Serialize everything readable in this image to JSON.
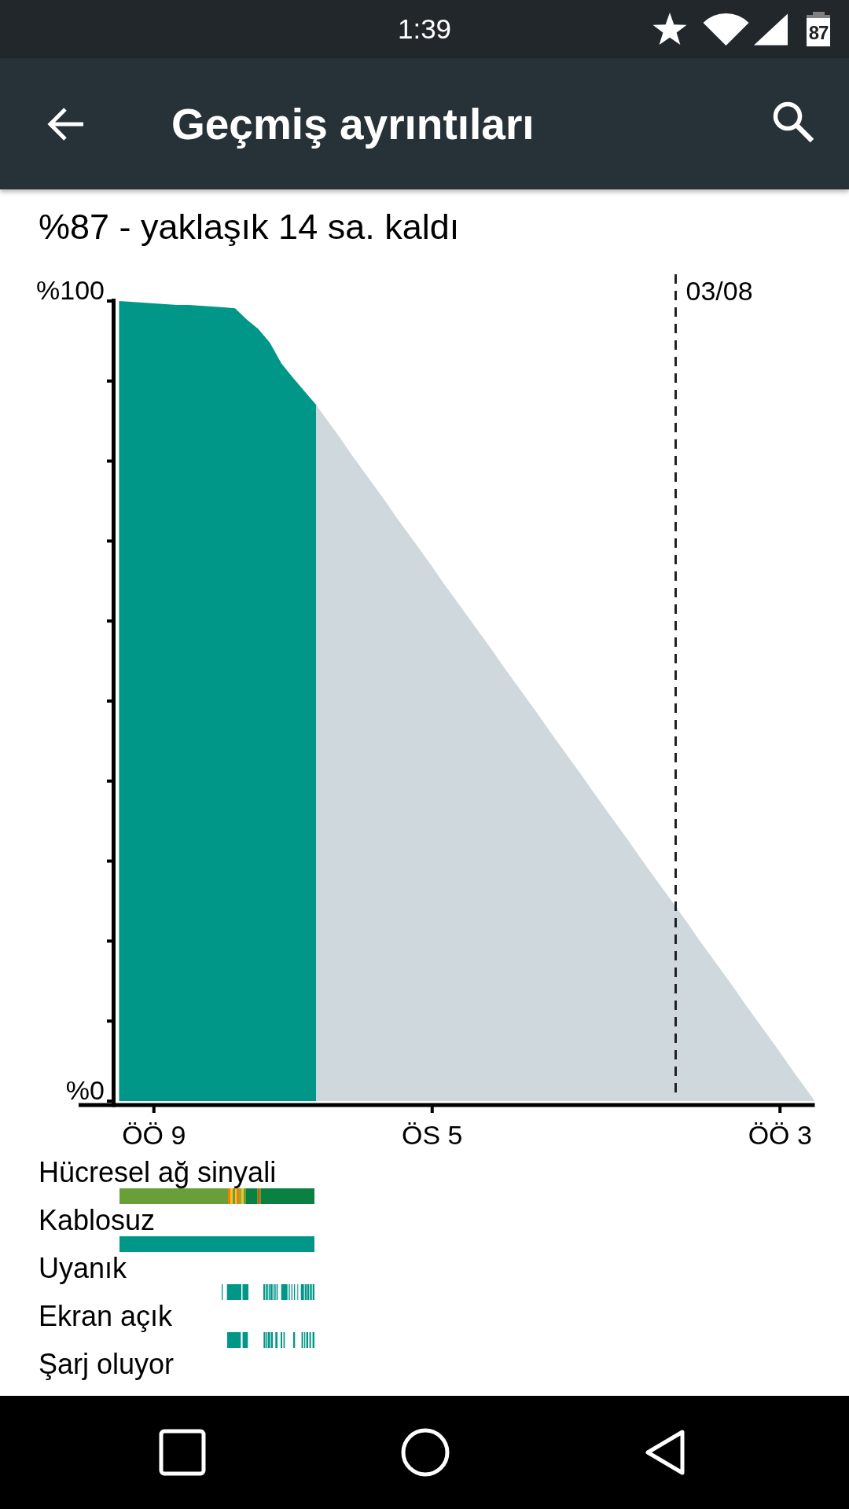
{
  "status_bar": {
    "time": "1:39",
    "battery_percent": "87"
  },
  "toolbar": {
    "title": "Geçmiş ayrıntıları"
  },
  "summary": "%87 - yaklaşık 14 sa. kaldı",
  "chart": {
    "chart_data": {
      "type": "area",
      "categories": [
        null,
        null,
        null,
        "ÖÖ 9",
        null,
        null,
        null,
        null,
        null,
        null,
        null,
        null,
        null,
        null,
        null,
        null,
        null,
        null,
        null,
        null,
        null,
        null,
        null,
        null,
        null,
        null,
        null,
        "ÖS 5",
        null,
        null,
        null,
        null,
        null,
        null,
        null,
        null,
        null,
        null,
        null,
        null,
        null,
        null,
        null,
        null,
        null,
        null,
        null,
        null,
        null,
        null,
        null,
        null,
        null,
        null,
        null,
        null,
        null,
        "ÖÖ 3",
        null,
        null,
        null
      ],
      "series": [
        {
          "color": "#009688",
          "values": [
            100,
            99.9,
            99.8,
            99.7,
            99.6,
            99.5,
            99.5,
            99.4,
            99.3,
            99.2,
            99.1,
            97.7,
            96.5,
            94.8,
            92.2,
            90.4,
            88.7,
            87,
            null,
            null,
            null,
            null,
            null,
            null,
            null,
            null,
            null,
            null,
            null,
            null,
            null,
            null,
            null,
            null,
            null,
            null,
            null,
            null,
            null,
            null,
            null,
            null,
            null,
            null,
            null,
            null,
            null,
            null,
            null,
            null,
            null,
            null,
            null,
            null,
            null,
            null,
            null,
            null,
            null,
            null,
            null
          ]
        },
        {
          "color": "#cfd8dc",
          "values": [
            null,
            null,
            null,
            null,
            null,
            null,
            null,
            null,
            null,
            null,
            null,
            null,
            null,
            null,
            null,
            null,
            null,
            87,
            85,
            83,
            80.9,
            78.9,
            76.9,
            74.9,
            72.8,
            70.8,
            68.8,
            66.8,
            64.7,
            62.7,
            60.7,
            58.7,
            56.7,
            54.6,
            52.6,
            50.6,
            48.6,
            46.5,
            44.5,
            42.5,
            40.5,
            38.4,
            36.4,
            34.4,
            32.4,
            30.3,
            28.3,
            26.3,
            24.3,
            22.3,
            20.2,
            18.2,
            16.2,
            14.2,
            12.1,
            10.1,
            8.1,
            6.1,
            4,
            2,
            0
          ]
        }
      ],
      "ylim": [
        0,
        100
      ],
      "yticks": [
        {
          "value": 0,
          "label": "%0"
        },
        {
          "value": 100,
          "label": "%100"
        }
      ],
      "annotations": [
        "03/08"
      ]
    }
  },
  "timeline_rows": [
    {
      "label": "Hücresel ağ sinyali",
      "kind": "signal"
    },
    {
      "label": "Kablosuz",
      "kind": "wifi"
    },
    {
      "label": "Uyanık",
      "kind": "awake"
    },
    {
      "label": "Ekran açık",
      "kind": "screen"
    },
    {
      "label": "Şarj oluyor",
      "kind": "charging"
    }
  ]
}
